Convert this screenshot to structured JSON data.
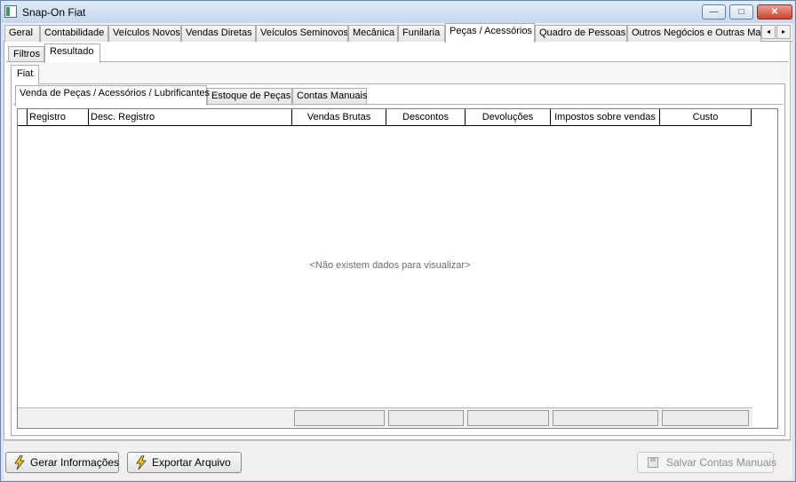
{
  "window": {
    "title": "Snap-On Fiat",
    "minimize_glyph": "—",
    "maximize_glyph": "□",
    "close_glyph": "✕"
  },
  "top_tabs": [
    {
      "label": "Geral"
    },
    {
      "label": "Contabilidade"
    },
    {
      "label": "Veículos Novos"
    },
    {
      "label": "Vendas Diretas"
    },
    {
      "label": "Veículos Seminovos"
    },
    {
      "label": "Mecânica"
    },
    {
      "label": "Funilaria"
    },
    {
      "label": "Peças / Acessórios"
    },
    {
      "label": "Quadro de Pessoas"
    },
    {
      "label": "Outros Negócios e Outras Mar"
    }
  ],
  "tab_scroll": {
    "left": "◂",
    "right": "▸"
  },
  "sub_tabs": [
    {
      "label": "Filtros"
    },
    {
      "label": "Resultado"
    }
  ],
  "brand_tab": {
    "label": "Fiat"
  },
  "report_tabs": [
    {
      "label": "Venda de Peças / Acessórios / Lubrificantes"
    },
    {
      "label": "Estoque de Peças"
    },
    {
      "label": "Contas Manuais"
    }
  ],
  "grid": {
    "columns": [
      {
        "label": "Registro"
      },
      {
        "label": "Desc. Registro"
      },
      {
        "label": "Vendas Brutas"
      },
      {
        "label": "Descontos"
      },
      {
        "label": "Devoluções"
      },
      {
        "label": "Impostos sobre vendas"
      },
      {
        "label": "Custo"
      }
    ],
    "empty_message": "<Não existem dados para visualizar>"
  },
  "buttons": {
    "generate": "Gerar Informações",
    "export": "Exportar Arquivo",
    "save_manual": "Salvar Contas Manuais"
  },
  "colors": {
    "lightning": "#f5c518",
    "window_accent": "#c6d8ee"
  }
}
